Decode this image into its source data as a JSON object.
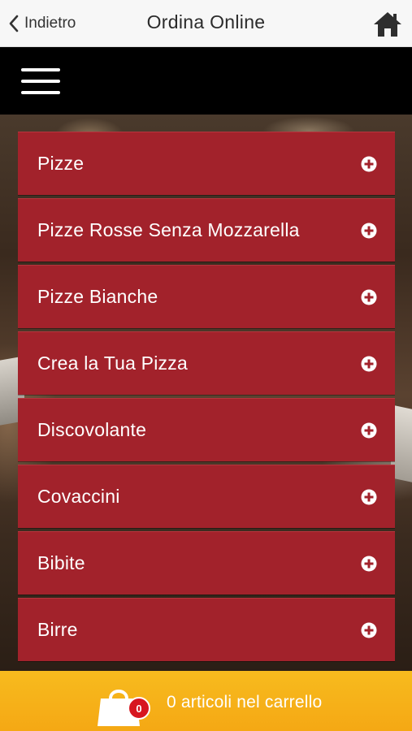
{
  "header": {
    "back_label": "Indietro",
    "title": "Ordina Online",
    "back_icon": "chevron-left-icon",
    "home_icon": "home-icon"
  },
  "menu": {
    "icon": "hamburger-menu-icon"
  },
  "categories": [
    {
      "label": "Pizze"
    },
    {
      "label": "Pizze Rosse Senza Mozzarella"
    },
    {
      "label": "Pizze Bianche"
    },
    {
      "label": "Crea la Tua Pizza"
    },
    {
      "label": "Discovolante"
    },
    {
      "label": "Covaccini"
    },
    {
      "label": "Bibite"
    },
    {
      "label": "Birre"
    }
  ],
  "cart": {
    "count": "0",
    "text": "0 articoli nel carrello",
    "icon": "shopping-bag-icon"
  },
  "colors": {
    "category_bg": "#a2222b",
    "cart_bar": "#f5a814",
    "badge": "#d7161f",
    "menubar": "#000000"
  }
}
